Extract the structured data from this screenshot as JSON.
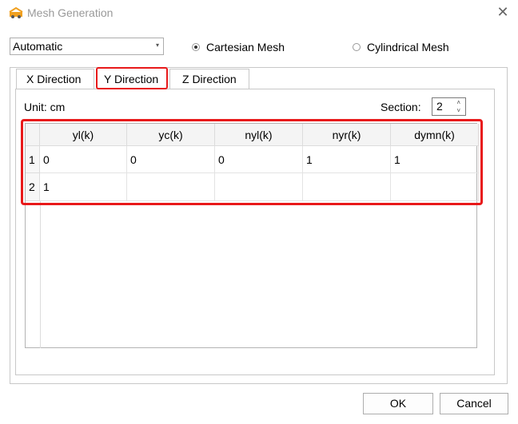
{
  "window": {
    "title": "Mesh Generation",
    "close_symbol": "✕"
  },
  "mode": {
    "selected": "Automatic"
  },
  "radios": {
    "cartesian": {
      "label": "Cartesian  Mesh",
      "checked": true
    },
    "cylindrical": {
      "label": "Cylindrical Mesh",
      "checked": false
    }
  },
  "tabs": [
    {
      "label": "X Direction"
    },
    {
      "label": "Y Direction"
    },
    {
      "label": "Z Direction"
    }
  ],
  "unit_label": "Unit: cm",
  "section": {
    "label": "Section:",
    "value": "2"
  },
  "grid": {
    "columns": [
      "yl(k)",
      "yc(k)",
      "nyl(k)",
      "nyr(k)",
      "dymn(k)"
    ],
    "rows": [
      {
        "index": "1",
        "cells": [
          "0",
          "0",
          "0",
          "1",
          "1"
        ]
      },
      {
        "index": "2",
        "cells": [
          "1",
          "",
          "",
          "",
          ""
        ]
      }
    ]
  },
  "buttons": {
    "ok": "OK",
    "cancel": "Cancel"
  },
  "colors": {
    "highlight": "#e8191a",
    "icon": "#f0a020"
  },
  "icons": [
    "mesh-app-icon",
    "close-icon",
    "dropdown-arrow-icon",
    "spin-up-icon",
    "spin-down-icon"
  ]
}
